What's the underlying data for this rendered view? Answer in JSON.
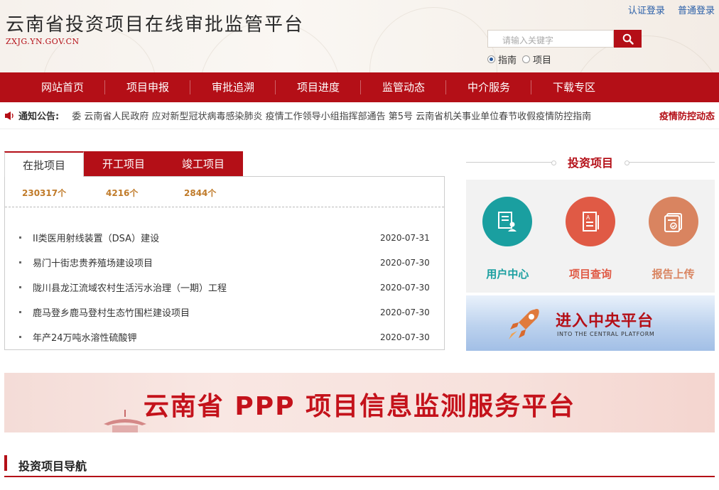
{
  "header": {
    "title": "云南省投资项目在线审批监管平台",
    "domain": "ZXJG.YN.GOV.CN",
    "links": [
      "认证登录",
      "普通登录"
    ],
    "search": {
      "placeholder": "请输入关键字",
      "options": [
        "指南",
        "项目"
      ],
      "selected": "指南"
    }
  },
  "nav": {
    "items": [
      "网站首页",
      "项目申报",
      "审批追溯",
      "项目进度",
      "监管动态",
      "中介服务",
      "下载专区"
    ]
  },
  "notice": {
    "label": "通知公告:",
    "text": "委 云南省人民政府 应对新型冠状病毒感染肺炎 疫情工作领导小组指挥部通告 第5号 云南省机关事业单位春节收假疫情防控指南",
    "special_link": "疫情防控动态"
  },
  "projects": {
    "tabs": [
      "在批项目",
      "开工项目",
      "竣工项目"
    ],
    "active_tab": "在批项目",
    "counts": [
      "230317个",
      "4216个",
      "2844个"
    ],
    "items": [
      {
        "name": "II类医用射线装置（DSA）建设",
        "date": "2020-07-31"
      },
      {
        "name": "易门十街忠贵养殖场建设项目",
        "date": "2020-07-30"
      },
      {
        "name": "陇川县龙江流域农村生活污水治理（一期）工程",
        "date": "2020-07-30"
      },
      {
        "name": "鹿马登乡鹿马登村生态竹围栏建设项目",
        "date": "2020-07-30"
      },
      {
        "name": "年产24万吨水溶性硫酸钾",
        "date": "2020-07-30"
      }
    ]
  },
  "investment": {
    "title": "投资项目",
    "services": [
      {
        "label": "用户中心",
        "color": "#1a9fa0",
        "icon": "user-document-icon"
      },
      {
        "label": "项目查询",
        "color": "#e05a45",
        "icon": "document-list-icon"
      },
      {
        "label": "报告上传",
        "color": "#d98460",
        "icon": "report-upload-icon"
      }
    ],
    "central": {
      "title": "进入中央平台",
      "subtitle": "INTO THE CENTRAL PLATFORM"
    }
  },
  "ppp_banner": {
    "text": "云南省 PPP 项目信息监测服务平台"
  },
  "section_nav": {
    "title": "投资项目导航"
  },
  "colors": {
    "brand_red": "#b40f17",
    "count_orange": "#c07b2a",
    "link_blue": "#2a5fa8"
  }
}
